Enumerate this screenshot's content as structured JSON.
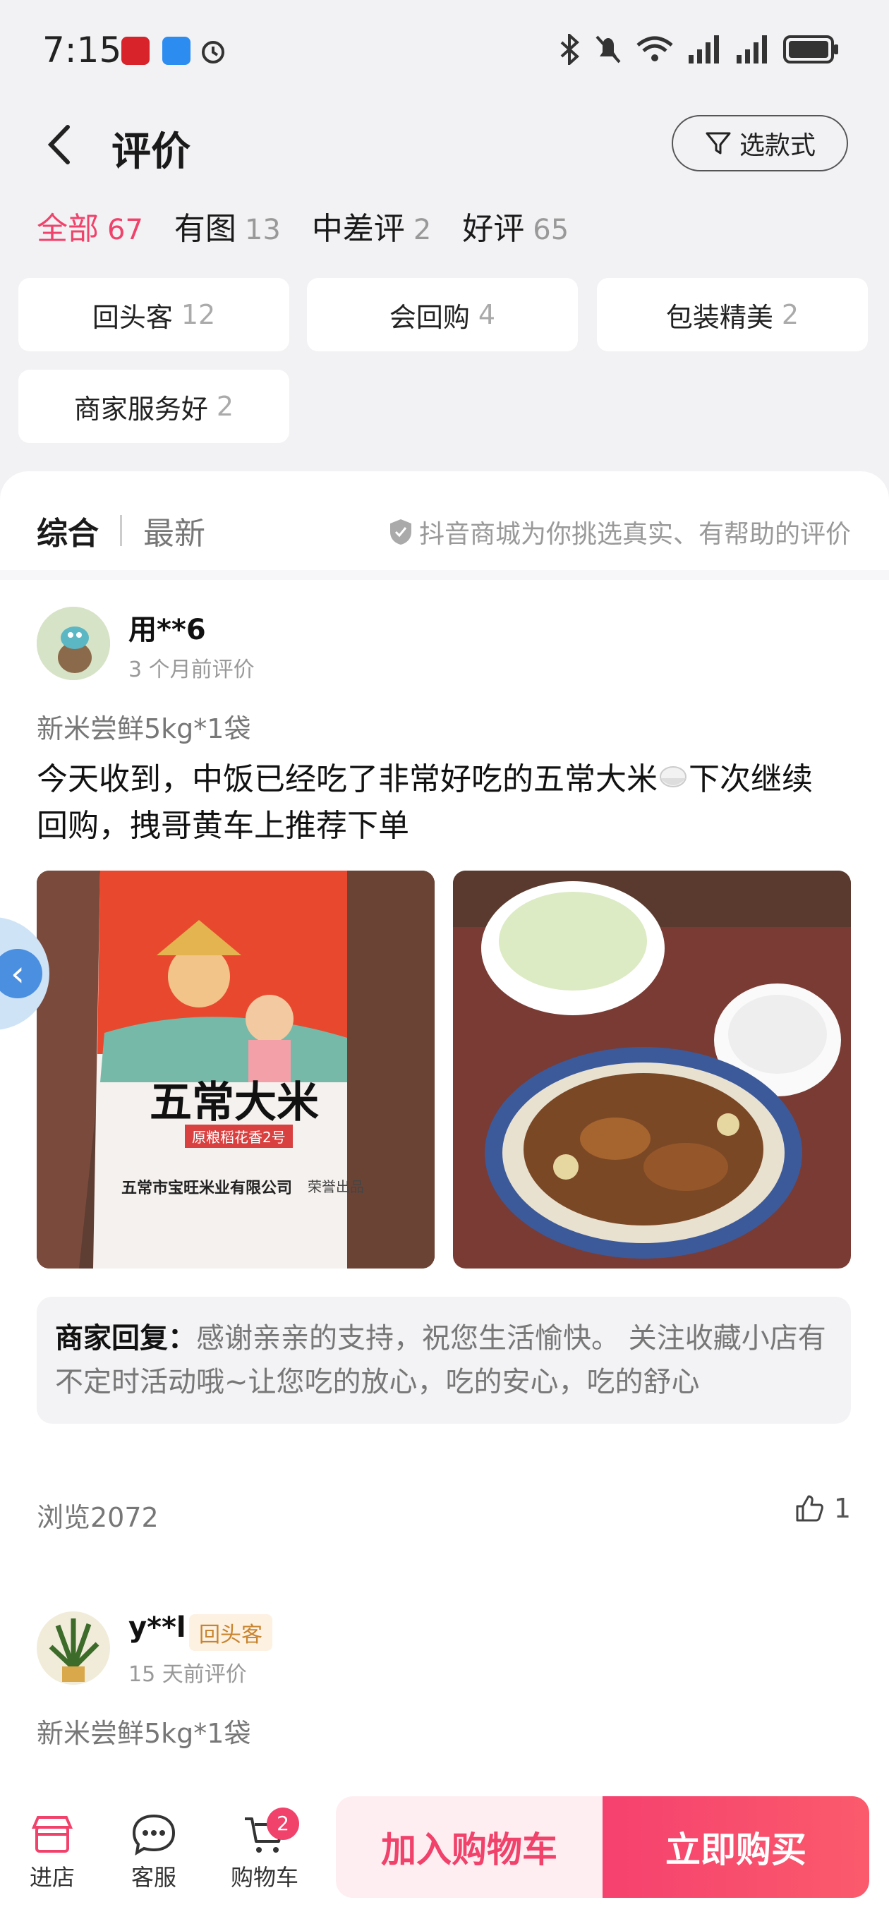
{
  "status_bar": {
    "time": "7:15"
  },
  "header": {
    "title": "评价",
    "style_button": "选款式"
  },
  "filter_tabs": [
    {
      "label": "全部",
      "count": "67"
    },
    {
      "label": "有图",
      "count": "13"
    },
    {
      "label": "中差评",
      "count": "2"
    },
    {
      "label": "好评",
      "count": "65"
    }
  ],
  "tag_chips": [
    {
      "label": "回头客",
      "count": "12"
    },
    {
      "label": "会回购",
      "count": "4"
    },
    {
      "label": "包装精美",
      "count": "2"
    },
    {
      "label": "商家服务好",
      "count": "2"
    }
  ],
  "sort": {
    "active": "综合",
    "other": "最新",
    "trust_note": "抖音商城为你挑选真实、有帮助的评价"
  },
  "reviews": [
    {
      "user": "用**6",
      "time": "3 个月前评价",
      "spec": "新米尝鲜5kg*1袋",
      "content_line1": "今天收到，中饭已经吃了非常好吃的五常大米",
      "content_line2": "下次继续",
      "content_line3": "回购，拽哥黄车上推荐下单",
      "photo1_title": "五常大米",
      "photo1_sub": "原粮稻花香2号",
      "photo1_company": "五常市宝旺米业有限公司",
      "photo1_brand": "荣誉出品",
      "reply_label": "商家回复：",
      "reply_text": "感谢亲亲的支持，祝您生活愉快。 关注收藏小店有不定时活动哦~让您吃的放心，吃的安心，吃的舒心",
      "views": "浏览2072",
      "likes": "1"
    },
    {
      "user": "y**l",
      "badge": "回头客",
      "time": "15 天前评价",
      "spec": "新米尝鲜5kg*1袋"
    }
  ],
  "bottom_bar": {
    "shop": "进店",
    "service": "客服",
    "cart": "购物车",
    "cart_badge": "2",
    "add_to_cart": "加入购物车",
    "buy_now": "立即购买"
  }
}
